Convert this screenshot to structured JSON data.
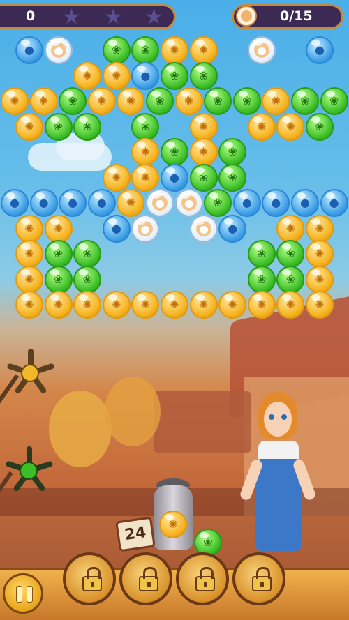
{
  "hud": {
    "score": "0",
    "stars_total": 3,
    "goal_progress": "0/15",
    "goal_icon": "dog-face-icon"
  },
  "shooter": {
    "moves_left": "24",
    "current_bubble": "orange",
    "next_bubble": "green"
  },
  "boosters": [
    {
      "name": "locked-booster-1",
      "icon": "lock-icon",
      "locked": true
    },
    {
      "name": "locked-booster-2",
      "icon": "lock-icon",
      "locked": true
    },
    {
      "name": "locked-booster-3",
      "icon": "lock-icon",
      "locked": true
    },
    {
      "name": "locked-booster-4",
      "icon": "lock-icon",
      "locked": true
    }
  ],
  "pause_icon": "pause-icon",
  "colors": {
    "blue": "#3fa0e6",
    "green": "#3cbf26",
    "orange": "#f6b21c",
    "hud_bg": "#3c2a55",
    "frame": "#c48a3c"
  },
  "board": {
    "rows": [
      "B,D,_,G,G,O,O,_,D,_,B",
      "_,_,O,O,B,G,G,_,_,_,_",
      "O,O,G,O,O,G,O,G,G,O,G,G",
      "O,G,G,_,G,_,O,_,O,O,G",
      "_,_,_,_,O,G,O,G,_,_,_",
      "_,_,_,O,O,B,G,G,_,_,_",
      "B,B,B,B,O,D,D,G,B,B,B,B",
      "O,O,_,B,D,_,D,B,_,O,O",
      "O,G,G,_,_,_,_,_,G,G,O",
      "O,G,G,_,_,_,_,_,G,G,O",
      "O,O,O,O,O,O,O,O,O,O,O"
    ]
  }
}
